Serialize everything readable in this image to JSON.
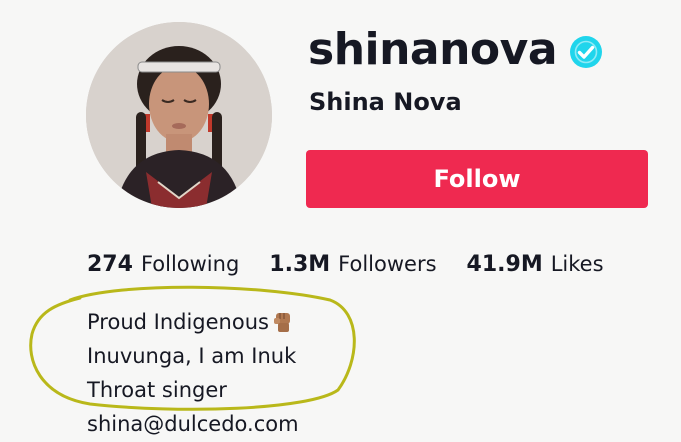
{
  "profile": {
    "username": "shinanova",
    "display_name": "Shina Nova",
    "verified_icon": "verified-check-icon",
    "follow_label": "Follow"
  },
  "stats": {
    "following": {
      "value": "274",
      "label": "Following"
    },
    "followers": {
      "value": "1.3M",
      "label": "Followers"
    },
    "likes": {
      "value": "41.9M",
      "label": "Likes"
    }
  },
  "bio": {
    "line1": "Proud Indigenous",
    "line1_icon": "raised-fist-icon",
    "line2": "Inuvunga, I am Inuk",
    "line3": "Throat singer",
    "email": "shina@dulcedo.com"
  },
  "colors": {
    "follow_button": "#ef2950",
    "verified_badge": "#20d5ec",
    "highlight_annotation": "#b9b81a",
    "text": "#161823"
  }
}
